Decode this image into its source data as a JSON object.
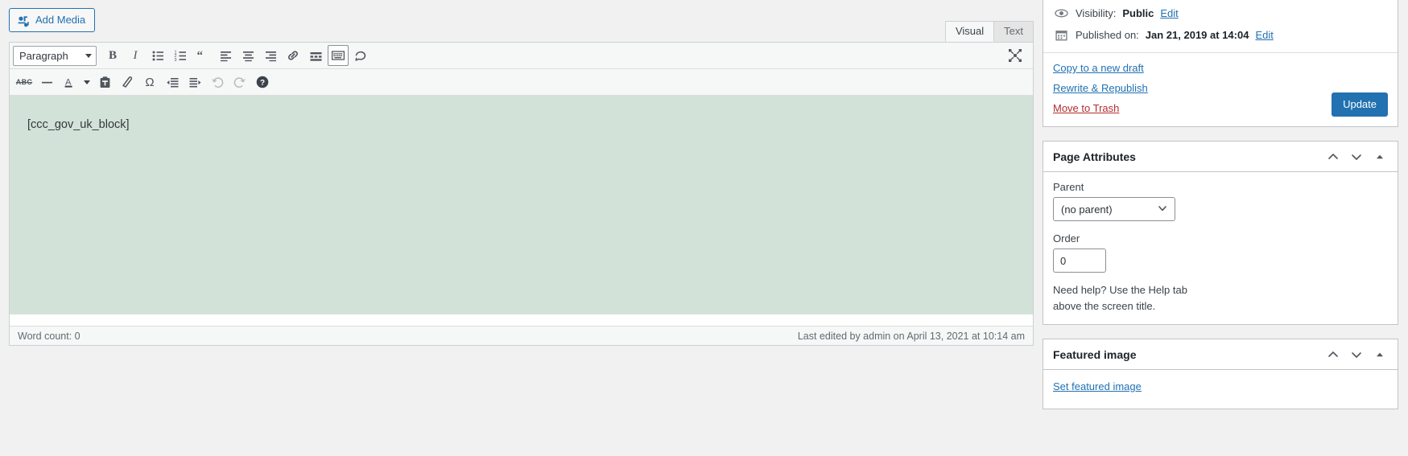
{
  "editor": {
    "add_media_label": "Add Media",
    "tabs": [
      {
        "label": "Visual",
        "active": true
      },
      {
        "label": "Text",
        "active": false
      }
    ],
    "format_select": "Paragraph",
    "toolbar_row1": [
      {
        "name": "bold",
        "glyph": "B"
      },
      {
        "name": "italic",
        "glyph": "I"
      },
      {
        "name": "bulleted-list",
        "glyph": ""
      },
      {
        "name": "numbered-list",
        "glyph": ""
      },
      {
        "name": "blockquote",
        "glyph": "“"
      },
      {
        "name": "align-left",
        "glyph": ""
      },
      {
        "name": "align-center",
        "glyph": ""
      },
      {
        "name": "align-right",
        "glyph": ""
      },
      {
        "name": "insert-link",
        "glyph": ""
      },
      {
        "name": "read-more",
        "glyph": ""
      },
      {
        "name": "toolbar-toggle",
        "glyph": ""
      },
      {
        "name": "spellcheck",
        "glyph": ""
      }
    ],
    "toolbar_row2": [
      {
        "name": "strikethrough",
        "glyph": "ABC"
      },
      {
        "name": "horizontal-line",
        "glyph": ""
      },
      {
        "name": "text-color",
        "glyph": "A"
      },
      {
        "name": "paste-as-text",
        "glyph": ""
      },
      {
        "name": "clear-formatting",
        "glyph": ""
      },
      {
        "name": "special-character",
        "glyph": "Ω"
      },
      {
        "name": "outdent",
        "glyph": ""
      },
      {
        "name": "indent",
        "glyph": ""
      },
      {
        "name": "undo",
        "glyph": ""
      },
      {
        "name": "redo",
        "glyph": ""
      },
      {
        "name": "keyboard-shortcuts-help",
        "glyph": "?"
      }
    ],
    "content": "[ccc_gov_uk_block]",
    "word_count": "Word count: 0",
    "last_edited": "Last edited by admin on April 13, 2021 at 10:14 am"
  },
  "publish": {
    "visibility_label": "Visibility:",
    "visibility_value": "Public",
    "visibility_edit": "Edit",
    "published_label": "Published on:",
    "published_value": "Jan 21, 2019 at 14:04",
    "published_edit": "Edit",
    "copy_draft": "Copy to a new draft",
    "rewrite_republish": "Rewrite & Republish",
    "move_to_trash": "Move to Trash",
    "update_button": "Update"
  },
  "page_attributes": {
    "title": "Page Attributes",
    "parent_label": "Parent",
    "parent_value": "(no parent)",
    "order_label": "Order",
    "order_value": "0",
    "help_text": "Need help? Use the Help tab above the screen title."
  },
  "featured_image": {
    "title": "Featured image",
    "set_link": "Set featured image"
  },
  "colors": {
    "accent": "#2271b1",
    "danger": "#b32d2e",
    "content_bg": "#d3e2d8"
  }
}
